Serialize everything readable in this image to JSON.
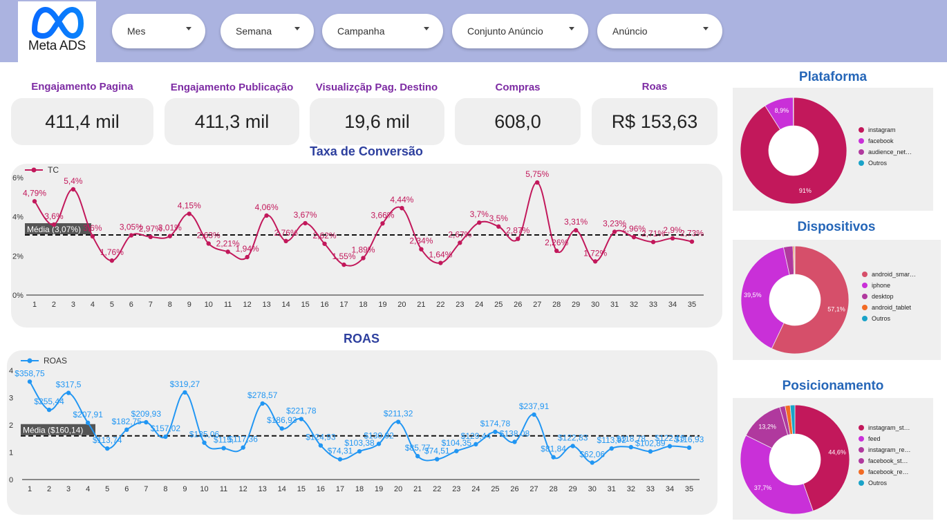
{
  "header": {
    "logo_text": "Meta ADS",
    "filters": [
      {
        "label": "Mes"
      },
      {
        "label": "Semana"
      },
      {
        "label": "Campanha"
      },
      {
        "label": "Conjunto Anúncio"
      },
      {
        "label": "Anúncio"
      }
    ]
  },
  "kpis": [
    {
      "label": "Engajamento Pagina",
      "value": "411,4 mil"
    },
    {
      "label": "Engajamento Publicação",
      "value": "411,3 mil"
    },
    {
      "label": "Visualizçãp Pag. Destino",
      "value": "19,6 mil"
    },
    {
      "label": "Compras",
      "value": "608,0"
    },
    {
      "label": "Roas",
      "value": "R$ 153,63"
    }
  ],
  "colors": {
    "tc_line": "#c2185b",
    "roas_line": "#2196f3",
    "instagram": "#c2185b",
    "facebook": "#c930d8",
    "audience_network": "#b0399e",
    "outros": "#1aa3c8",
    "android_smartphone": "#d64f6a",
    "iphone": "#c930d8",
    "desktop": "#b0399e",
    "android_tablet": "#f26b25"
  },
  "chart_data": [
    {
      "type": "line",
      "title": "Taxa de Conversão",
      "x": [
        1,
        2,
        3,
        4,
        5,
        6,
        7,
        8,
        9,
        10,
        11,
        12,
        13,
        14,
        15,
        16,
        17,
        18,
        19,
        20,
        21,
        22,
        23,
        24,
        25,
        26,
        27,
        28,
        29,
        30,
        31,
        32,
        33,
        34,
        35
      ],
      "series": [
        {
          "name": "TC",
          "values": [
            4.79,
            3.6,
            5.4,
            3.0,
            1.76,
            3.05,
            2.97,
            3.01,
            4.15,
            2.63,
            2.21,
            1.94,
            4.06,
            2.76,
            3.67,
            2.62,
            1.55,
            1.89,
            3.66,
            4.44,
            2.34,
            1.64,
            2.67,
            3.7,
            3.5,
            2.87,
            5.75,
            2.26,
            3.31,
            1.72,
            3.23,
            2.96,
            2.71,
            2.9,
            2.73
          ],
          "labels": [
            "4,79%",
            "3,6%",
            "5,4%",
            "3,6%",
            "1,76%",
            "3,05%",
            "2,97%",
            "3,01%",
            "4,15%",
            "2,63%",
            "2,21%",
            "1,94%",
            "4,06%",
            "2,76%",
            "3,67%",
            "2,62%",
            "1,55%",
            "1,89%",
            "3,66%",
            "4,44%",
            "2,34%",
            "1,64%",
            "2,67%",
            "3,7%",
            "3,5%",
            "2,87%",
            "5,75%",
            "2,26%",
            "3,31%",
            "1,72%",
            "3,23%",
            "2,96%",
            "2,71%",
            "2,9%",
            "2,73%"
          ]
        }
      ],
      "reference_line": {
        "value": 3.07,
        "label": "Média (3,07%)"
      },
      "yticks": [
        "0%",
        "2%",
        "4%",
        "6%"
      ],
      "ylim": [
        0,
        6
      ],
      "legend": "top-left"
    },
    {
      "type": "line",
      "title": "ROAS",
      "x": [
        1,
        2,
        3,
        4,
        5,
        6,
        7,
        8,
        9,
        10,
        11,
        12,
        13,
        14,
        15,
        16,
        17,
        18,
        19,
        20,
        21,
        22,
        23,
        24,
        25,
        26,
        27,
        28,
        29,
        30,
        31,
        32,
        33,
        34,
        35
      ],
      "series": [
        {
          "name": "ROAS",
          "values": [
            358.75,
            255.44,
            317.5,
            207.91,
            113.74,
            182.75,
            209.93,
            157.02,
            319.27,
            135.06,
            115.0,
            117.36,
            278.57,
            186.93,
            221.78,
            124.93,
            74.31,
            103.38,
            130.92,
            211.32,
            85.77,
            74.51,
            104.35,
            129.44,
            174.78,
            138.08,
            237.91,
            81.84,
            122.83,
            62.06,
            113.92,
            118.78,
            102.89,
            122.13,
            116.93
          ],
          "labels": [
            "$358,75",
            "$255,44",
            "$317,5",
            "$207,91",
            "$113,74",
            "$182,75",
            "$209,93",
            "$157,02",
            "$319,27",
            "$135,06",
            "$115,",
            "$117,36",
            "$278,57",
            "$186,93",
            "$221,78",
            "$124,93",
            "$74,31",
            "$103,38",
            "$130,92",
            "$211,32",
            "$85,77",
            "$74,51",
            "$104,35",
            "$129,44",
            "$174,78",
            "$138,08",
            "$237,91",
            "$81,84",
            "$122,83",
            "$62,06",
            "$113,92",
            "$118,78",
            "$102,89",
            "$122,13",
            "$116,93"
          ]
        }
      ],
      "reference_line": {
        "value": 160.14,
        "label": "Média ($160,14)"
      },
      "yticks": [
        "0",
        "1",
        "2",
        "3",
        "4"
      ],
      "ylim": [
        0,
        400
      ],
      "legend": "top-left"
    },
    {
      "type": "pie",
      "title": "Plataforma",
      "slices": [
        {
          "name": "instagram",
          "value": 91,
          "label": "91%"
        },
        {
          "name": "facebook",
          "value": 8.9,
          "label": "8,9%"
        },
        {
          "name": "audience_net…",
          "value": 0.05,
          "label": ""
        },
        {
          "name": "Outros",
          "value": 0.05,
          "label": ""
        }
      ]
    },
    {
      "type": "pie",
      "title": "Dispositivos",
      "slices": [
        {
          "name": "android_smar…",
          "value": 57.1,
          "label": "57,1%"
        },
        {
          "name": "iphone",
          "value": 39.5,
          "label": "39,5%"
        },
        {
          "name": "desktop",
          "value": 2.8,
          "label": ""
        },
        {
          "name": "android_tablet",
          "value": 0.4,
          "label": ""
        },
        {
          "name": "Outros",
          "value": 0.2,
          "label": ""
        }
      ]
    },
    {
      "type": "pie",
      "title": "Posicionamento",
      "slices": [
        {
          "name": "instagram_st…",
          "value": 44.6,
          "label": "44,6%"
        },
        {
          "name": "feed",
          "value": 37.7,
          "label": "37,7%"
        },
        {
          "name": "instagram_re…",
          "value": 13.2,
          "label": "13,2%"
        },
        {
          "name": "facebook_st…",
          "value": 1.6,
          "label": ""
        },
        {
          "name": "facebook_re…",
          "value": 1.5,
          "label": ""
        },
        {
          "name": "Outros",
          "value": 1.4,
          "label": ""
        }
      ]
    }
  ]
}
